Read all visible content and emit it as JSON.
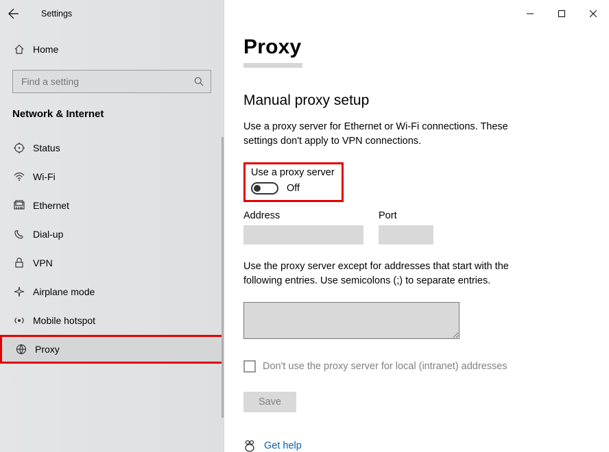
{
  "window": {
    "title": "Settings"
  },
  "sidebar": {
    "home": "Home",
    "search_placeholder": "Find a setting",
    "section": "Network & Internet",
    "items": [
      {
        "label": "Status",
        "icon": "status-icon"
      },
      {
        "label": "Wi-Fi",
        "icon": "wifi-icon"
      },
      {
        "label": "Ethernet",
        "icon": "ethernet-icon"
      },
      {
        "label": "Dial-up",
        "icon": "dialup-icon"
      },
      {
        "label": "VPN",
        "icon": "vpn-icon"
      },
      {
        "label": "Airplane mode",
        "icon": "airplane-icon"
      },
      {
        "label": "Mobile hotspot",
        "icon": "hotspot-icon"
      },
      {
        "label": "Proxy",
        "icon": "proxy-icon",
        "selected": true
      }
    ]
  },
  "content": {
    "page_title": "Proxy",
    "section_title": "Manual proxy setup",
    "description": "Use a proxy server for Ethernet or Wi-Fi connections. These settings don't apply to VPN connections.",
    "proxy_toggle": {
      "label": "Use a proxy server",
      "state": "Off"
    },
    "address_label": "Address",
    "address_value": "",
    "port_label": "Port",
    "port_value": "",
    "exceptions_label": "Use the proxy server except for addresses that start with the following entries. Use semicolons (;) to separate entries.",
    "exceptions_value": "",
    "local_bypass_label": "Don't use the proxy server for local (intranet) addresses",
    "save_label": "Save",
    "help_label": "Get help"
  }
}
